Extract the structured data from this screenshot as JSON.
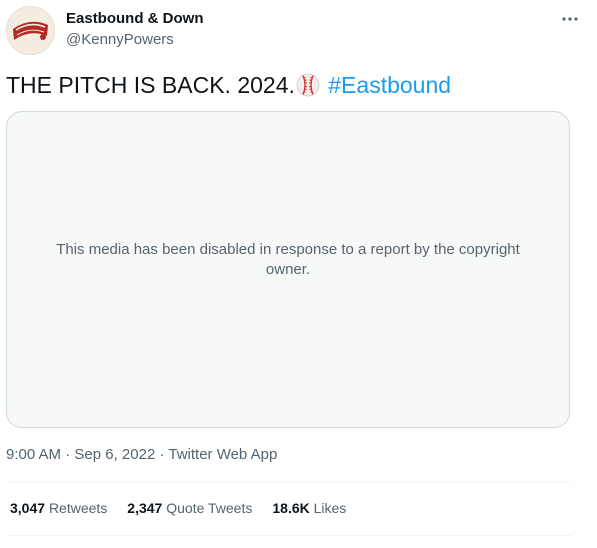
{
  "author": {
    "display_name": "Eastbound & Down",
    "handle": "@KennyPowers",
    "avatar_logo_text": "Eastbound & Down"
  },
  "tweet": {
    "text": "THE PITCH IS BACK. 2024.",
    "emoji_icon": "baseball-icon",
    "hashtag": "#Eastbound"
  },
  "media": {
    "message": "This media has been disabled in response to a report by the copyright owner."
  },
  "meta": {
    "time": "9:00 AM",
    "sep1": " · ",
    "date": "Sep 6, 2022",
    "sep2": " · ",
    "source": "Twitter Web App"
  },
  "stats": [
    {
      "count": "3,047",
      "label": "Retweets"
    },
    {
      "count": "2,347",
      "label": "Quote Tweets"
    },
    {
      "count": "18.6K",
      "label": "Likes"
    }
  ],
  "menu_icon": "more-horizontal-icon",
  "colors": {
    "link": "#1d9bf0",
    "secondary_text": "#536471",
    "primary_text": "#0f1419",
    "media_bg": "#f7f9f9",
    "border": "#cfd9de"
  }
}
